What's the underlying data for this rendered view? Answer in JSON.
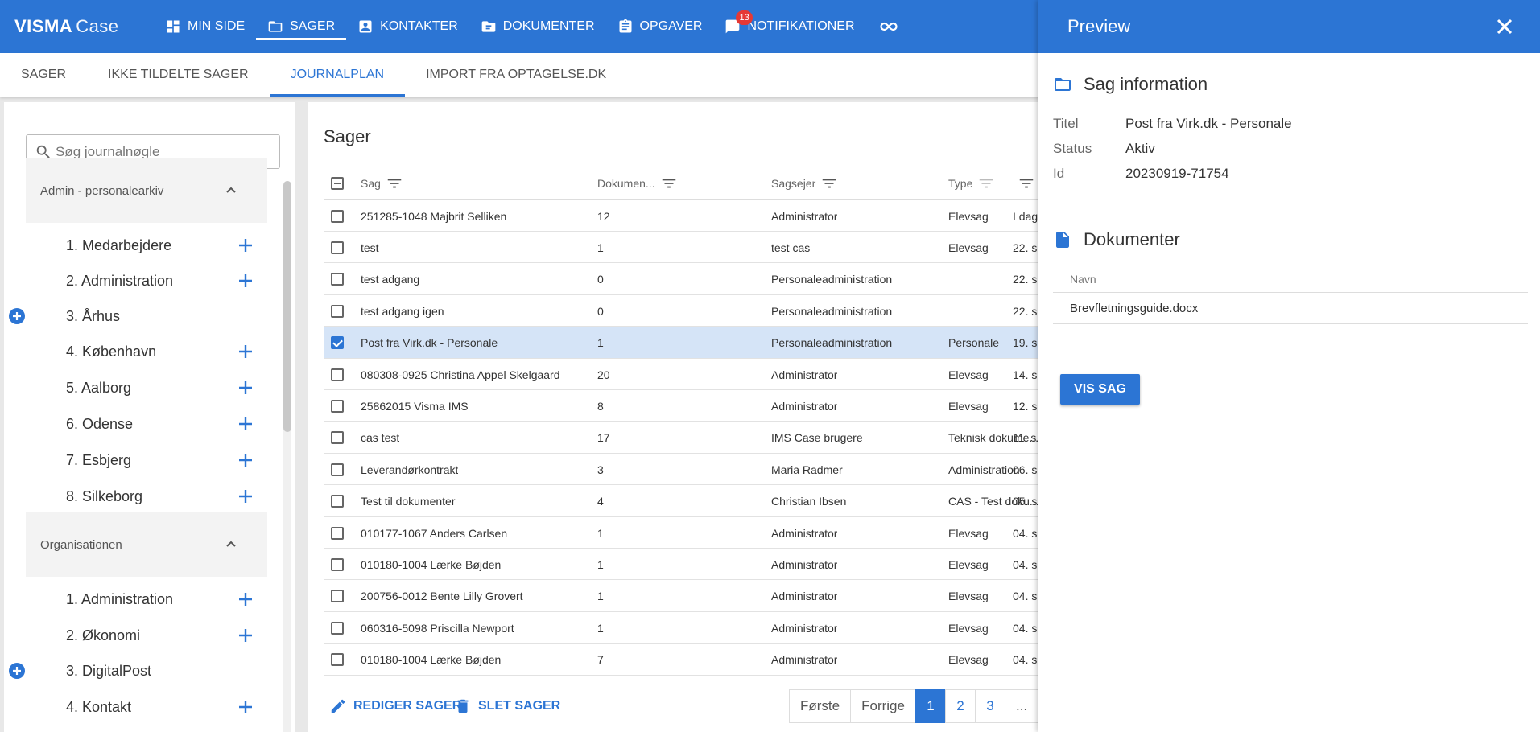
{
  "app": {
    "logo_bold": "VISMA",
    "logo_light": "Case"
  },
  "nav": {
    "items": [
      {
        "label": "MIN SIDE",
        "icon": "dashboard-icon"
      },
      {
        "label": "SAGER",
        "icon": "folder-icon"
      },
      {
        "label": "KONTAKTER",
        "icon": "contact-icon"
      },
      {
        "label": "DOKUMENTER",
        "icon": "documents-icon"
      },
      {
        "label": "OPGAVER",
        "icon": "clipboard-icon"
      },
      {
        "label": "NOTIFIKATIONER",
        "icon": "notification-icon",
        "badge": "13"
      }
    ],
    "link_icon": "link-icon"
  },
  "subtabs": [
    "SAGER",
    "IKKE TILDELTE SAGER",
    "JOURNALPLAN",
    "IMPORT FRA OPTAGELSE.DK"
  ],
  "left": {
    "search_placeholder": "Søg journalnøgle",
    "groups": [
      {
        "title": "Admin - personalearkiv",
        "items": [
          "1. Medarbejdere",
          "2. Administration",
          "3. Århus",
          "4. København",
          "5. Aalborg",
          "6. Odense",
          "7. Esbjerg",
          "8. Silkeborg"
        ]
      },
      {
        "title": "Organisationen",
        "items": [
          "1. Administration",
          "2. Økonomi",
          "3. DigitalPost",
          "4. Kontakt"
        ]
      }
    ]
  },
  "main": {
    "title": "Sager",
    "columns": [
      "Sag",
      "Dokumen...",
      "Sagsejer",
      "Type"
    ],
    "rows": [
      [
        "251285-1048 Majbrit Selliken",
        "12",
        "Administrator",
        "Elevsag",
        "I dag"
      ],
      [
        "test",
        "1",
        "test cas",
        "Elevsag",
        "22. s."
      ],
      [
        "test adgang",
        "0",
        "Personaleadministration",
        "",
        "22. s."
      ],
      [
        "test adgang igen",
        "0",
        "Personaleadministration",
        "",
        "22. s."
      ],
      [
        "Post fra Virk.dk - Personale",
        "1",
        "Personaleadministration",
        "Personale",
        "19. s."
      ],
      [
        "080308-0925 Christina Appel Skelgaard",
        "20",
        "Administrator",
        "Elevsag",
        "14. s."
      ],
      [
        "25862015 Visma IMS",
        "8",
        "Administrator",
        "Elevsag",
        "12. s."
      ],
      [
        "cas test",
        "17",
        "IMS Case brugere",
        "Teknisk dokume...",
        "11. s."
      ],
      [
        "Leverandørkontrakt",
        "3",
        "Maria Radmer",
        "Administration",
        "06. s."
      ],
      [
        "Test til dokumenter",
        "4",
        "Christian Ibsen",
        "CAS - Test doku...",
        "05. s."
      ],
      [
        "010177-1067 Anders Carlsen",
        "1",
        "Administrator",
        "Elevsag",
        "04. s."
      ],
      [
        "010180-1004 Lærke Bøjden",
        "1",
        "Administrator",
        "Elevsag",
        "04. s."
      ],
      [
        "200756-0012 Bente Lilly Grovert",
        "1",
        "Administrator",
        "Elevsag",
        "04. s."
      ],
      [
        "060316-5098 Priscilla Newport",
        "1",
        "Administrator",
        "Elevsag",
        "04. s."
      ],
      [
        "010180-1004 Lærke Bøjden",
        "7",
        "Administrator",
        "Elevsag",
        "04. s."
      ]
    ],
    "selected_row": 4,
    "footer": {
      "edit_label": "REDIGER SAGER",
      "delete_label": "SLET SAGER",
      "pager": {
        "first": "Første",
        "prev": "Forrige",
        "pages": [
          "1",
          "2",
          "3"
        ],
        "ellipsis": "...",
        "current": "1"
      }
    }
  },
  "preview": {
    "title": "Preview",
    "info_title": "Sag information",
    "fields": [
      {
        "label": "Titel",
        "value": "Post fra Virk.dk - Personale"
      },
      {
        "label": "Status",
        "value": "Aktiv"
      },
      {
        "label": "Id",
        "value": "20230919-71754"
      }
    ],
    "docs_title": "Dokumenter",
    "docs_col": "Navn",
    "docs": [
      "Brevfletningsguide.docx"
    ],
    "show_button": "VIS SAG"
  },
  "colors": {
    "primary": "#2c75d4",
    "selected_row": "#d5e4f7",
    "badge": "#e53935"
  }
}
